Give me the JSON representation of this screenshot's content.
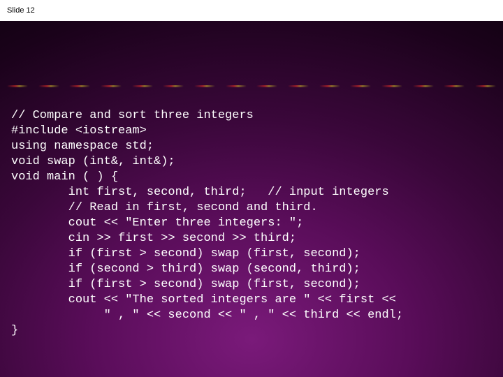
{
  "header": {
    "label": "Slide 12"
  },
  "code": {
    "l1": "// Compare and sort three integers",
    "l2": "#include <iostream>",
    "l3": "using namespace std;",
    "l4": "void swap (int&, int&);",
    "l5": "void main ( ) {",
    "l6": "        int first, second, third;   // input integers",
    "l7": "        // Read in first, second and third.",
    "l8": "        cout << \"Enter three integers: \";",
    "l9": "        cin >> first >> second >> third;",
    "l10": "        if (first > second) swap (first, second);",
    "l11": "        if (second > third) swap (second, third);",
    "l12": "        if (first > second) swap (first, second);",
    "l13": "        cout << \"The sorted integers are \" << first <<",
    "l14": "             \" , \" << second << \" , \" << third << endl;",
    "l15": "}"
  }
}
